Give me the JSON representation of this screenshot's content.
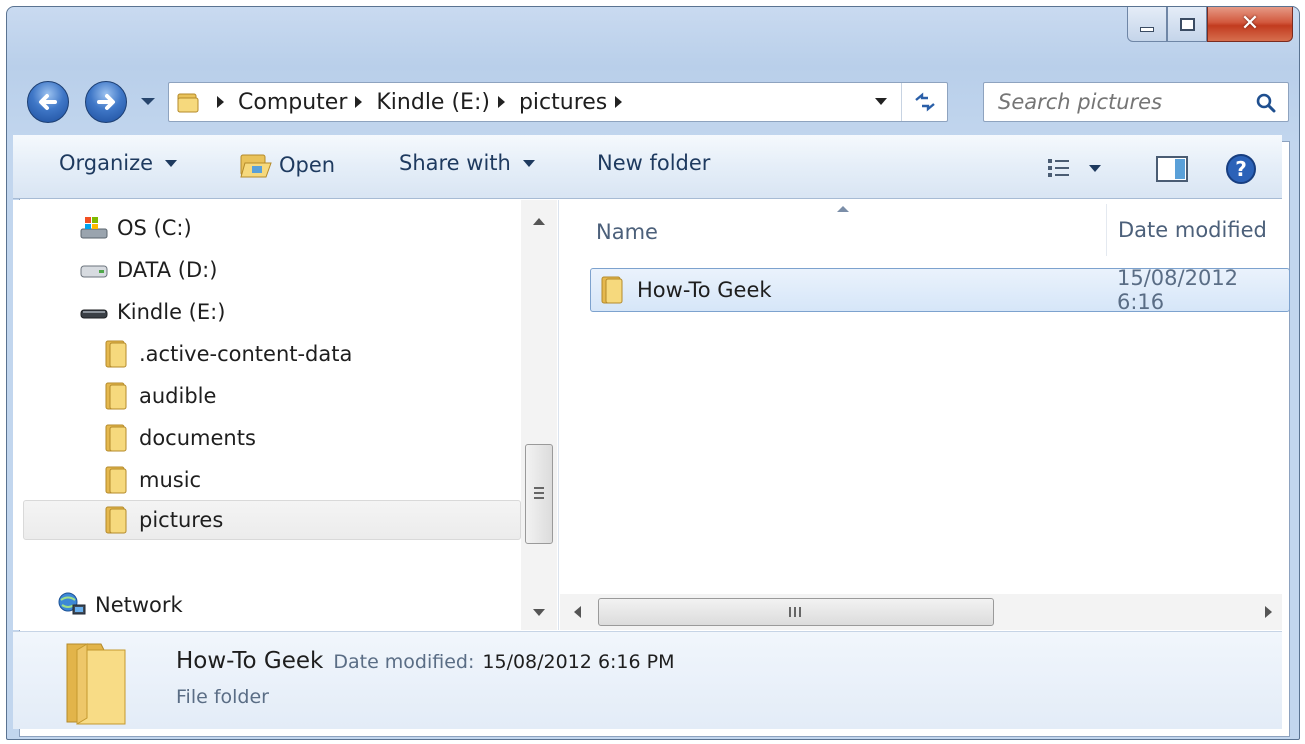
{
  "window": {
    "caption_buttons": [
      "minimize",
      "maximize",
      "close"
    ]
  },
  "navigation": {
    "breadcrumbs": [
      "Computer",
      "Kindle (E:)",
      "pictures"
    ],
    "search_placeholder": "Search pictures"
  },
  "toolbar": {
    "organize": "Organize",
    "open": "Open",
    "share_with": "Share with",
    "new_folder": "New folder"
  },
  "nav_pane": {
    "drives": [
      {
        "label": "OS (C:)",
        "icon": "os-drive-icon"
      },
      {
        "label": "DATA (D:)",
        "icon": "hard-drive-icon"
      },
      {
        "label": "Kindle (E:)",
        "icon": "removable-drive-icon"
      }
    ],
    "folders": [
      ".active-content-data",
      "audible",
      "documents",
      "music",
      "pictures"
    ],
    "selected": "pictures",
    "network": "Network"
  },
  "content": {
    "columns": {
      "name": "Name",
      "date_modified": "Date modified"
    },
    "rows": [
      {
        "name": "How-To Geek",
        "date_modified": "15/08/2012 6:16"
      }
    ]
  },
  "details": {
    "name": "How-To Geek",
    "date_label": "Date modified:",
    "date_value": "15/08/2012 6:16 PM",
    "type": "File folder"
  },
  "colors": {
    "chrome": "#c2d6ee",
    "selection": "#d6e6f8",
    "close_button": "#c23b1f"
  }
}
